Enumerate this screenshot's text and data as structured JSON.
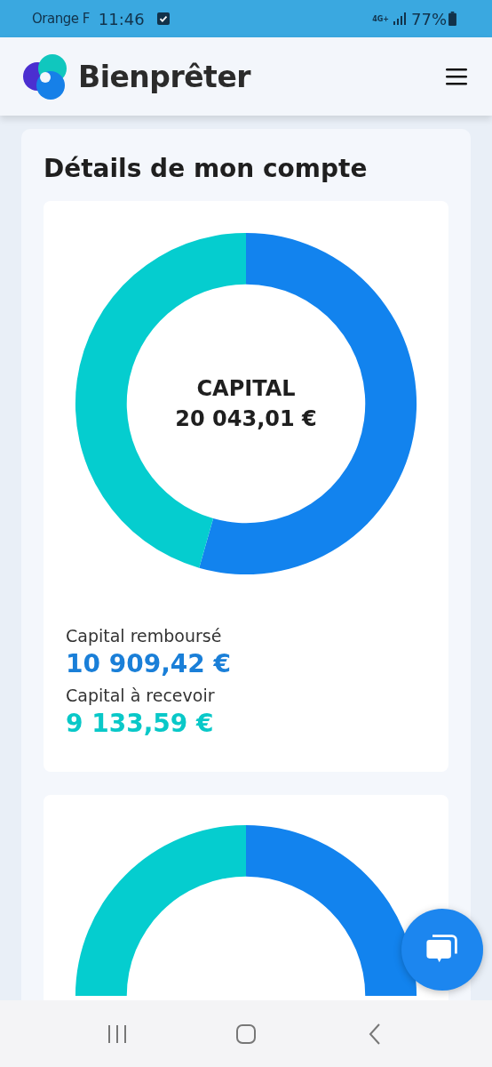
{
  "status_bar": {
    "carrier": "Orange F",
    "time": "11:46",
    "network": "4G+",
    "battery": "77%"
  },
  "header": {
    "brand": "Bienprêter"
  },
  "section": {
    "title": "Détails de mon compte"
  },
  "capital_card": {
    "center_title": "CAPITAL",
    "center_value": "20 043,01 €",
    "chart_data": {
      "type": "donut",
      "categories": [
        "Capital remboursé",
        "Capital à recevoir"
      ],
      "values": [
        54.43,
        45.57
      ]
    },
    "legend": [
      {
        "value": "10 909,42 €",
        "color": "#1a7fd8"
      },
      {
        "value": "9 133,59 €",
        "color": "#09c8c8"
      }
    ]
  }
}
